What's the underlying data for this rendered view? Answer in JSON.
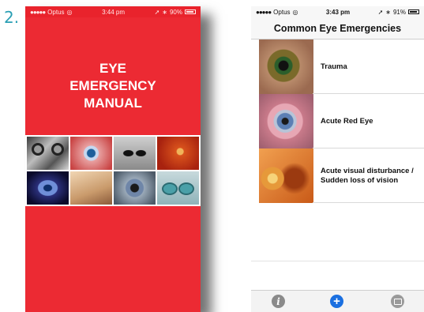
{
  "figure_label": "2.",
  "left_phone": {
    "status": {
      "carrier": "Optus",
      "time": "3:44 pm",
      "battery": "90%"
    },
    "title_lines": [
      "EYE",
      "EMERGENCY",
      "MANUAL"
    ]
  },
  "right_phone": {
    "status": {
      "carrier": "Optus",
      "time": "3:43 pm",
      "battery": "91%"
    },
    "nav_title": "Common Eye Emergencies",
    "items": [
      {
        "label": "Trauma"
      },
      {
        "label": "Acute Red Eye"
      },
      {
        "label": "Acute visual disturbance / Sudden loss of vision"
      }
    ],
    "tabbar": {
      "info_icon": "info-icon",
      "add_icon": "plus-circle-icon",
      "mail_icon": "mail-icon"
    }
  },
  "colors": {
    "cover_red": "#ec2a33",
    "accent_blue": "#1a6fe0",
    "label_teal": "#2a9fb4"
  }
}
